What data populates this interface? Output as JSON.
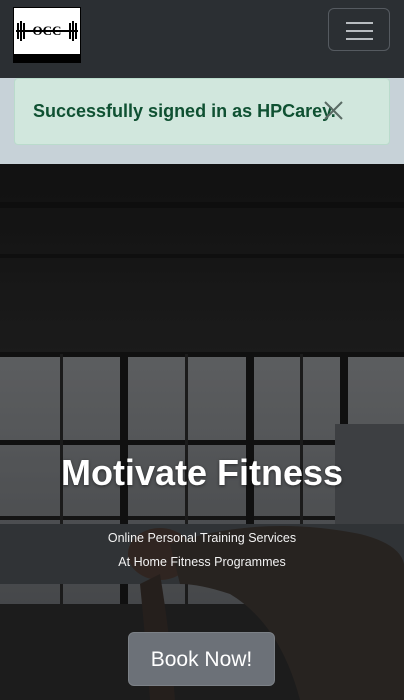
{
  "navbar": {
    "logo_alt_text": "OCC",
    "menu_icon": "hamburger-menu-icon"
  },
  "alert": {
    "message": "Successfully signed in as HPCarey.",
    "close_icon": "close-icon",
    "color": "#0f5132",
    "background": "#d1e7dd"
  },
  "hero": {
    "title": "Motivate Fitness",
    "line1": "Online Personal Training Services",
    "line2": "At Home Fitness Programmes",
    "button_label": "Book Now!"
  }
}
